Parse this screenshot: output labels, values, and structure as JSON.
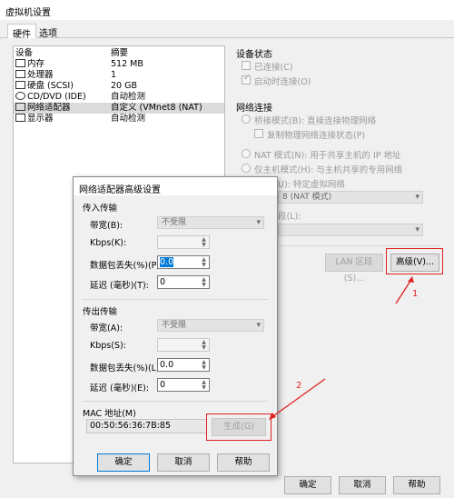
{
  "window": {
    "title": "虚拟机设置"
  },
  "tabs": [
    {
      "label": "硬件"
    },
    {
      "label": "选项"
    }
  ],
  "device_list": {
    "headers": {
      "device": "设备",
      "summary": "摘要"
    },
    "rows": [
      {
        "icon": "memory-icon",
        "device": "内存",
        "summary": "512 MB"
      },
      {
        "icon": "cpu-icon",
        "device": "处理器",
        "summary": "1"
      },
      {
        "icon": "harddisk-icon",
        "device": "硬盘 (SCSI)",
        "summary": "20 GB"
      },
      {
        "icon": "cdrom-icon",
        "device": "CD/DVD (IDE)",
        "summary": "自动检测"
      },
      {
        "icon": "network-adapter-icon",
        "device": "网络适配器",
        "summary": "自定义 (VMnet8 (NAT)"
      },
      {
        "icon": "display-icon",
        "device": "显示器",
        "summary": "自动检测"
      }
    ]
  },
  "device_status": {
    "title": "设备状态",
    "connected": "已连接(C)",
    "connect_on_start": "启动时连接(O)"
  },
  "network": {
    "title": "网络连接",
    "bridged": "桥接模式(B): 直接连接物理网络",
    "replicate": "复制物理网络连接状态(P)",
    "nat": "NAT 模式(N): 用于共享主机的 IP 地址",
    "host_only": "仅主机模式(H): 与主机共享的专用网络",
    "custom_partial": "U): 特定虚拟网络",
    "custom_value": "8 (NAT 模式)",
    "segment_label_partial": "段(L):",
    "lan_button": "LAN 区段(S)...",
    "advanced_button": "高级(V)..."
  },
  "main_buttons": {
    "ok": "确定",
    "cancel": "取消",
    "help": "帮助"
  },
  "dialog": {
    "title": "网络适配器高级设置",
    "incoming": {
      "title": "传入传输",
      "bandwidth_label": "带宽(B):",
      "bandwidth_value": "不受限",
      "kbps_label": "Kbps(K):",
      "loss_label": "数据包丢失(%)(P)",
      "loss_value": "0.0",
      "latency_label": "延迟 (毫秒)(T):",
      "latency_value": "0"
    },
    "outgoing": {
      "title": "传出传输",
      "bandwidth_label": "带宽(A):",
      "bandwidth_value": "不受限",
      "kbps_label": "Kbps(S):",
      "loss_label": "数据包丢失(%)(L):",
      "loss_value": "0.0",
      "latency_label": "延迟 (毫秒)(E):",
      "latency_value": "0"
    },
    "mac": {
      "label": "MAC 地址(M)",
      "value": "00:50:56:36:7B:85",
      "generate": "生成(G)"
    },
    "buttons": {
      "ok": "确定",
      "cancel": "取消",
      "help": "帮助"
    }
  },
  "annotations": {
    "one": "1",
    "two": "2"
  },
  "colors": {
    "annotation": "#e02020",
    "focus": "#0078d7"
  }
}
